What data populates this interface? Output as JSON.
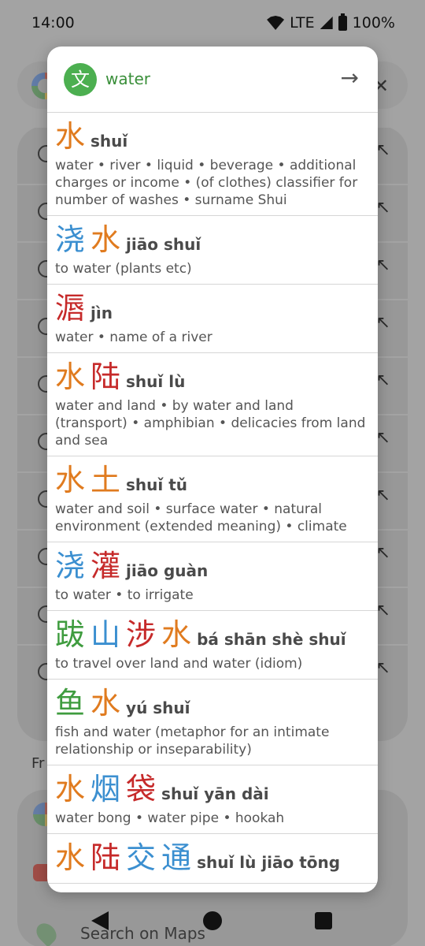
{
  "status_bar": {
    "time": "14:00",
    "network": "LTE",
    "battery": "100%"
  },
  "background": {
    "section_label": "Fr",
    "maps_label": "Search on Maps",
    "row_count": 10
  },
  "popup": {
    "app_icon_glyph": "文",
    "query": "water",
    "go_icon": "arrow-right",
    "entries": [
      {
        "chars": [
          {
            "c": "水",
            "tone": 1
          }
        ],
        "pinyin": "shuǐ",
        "definition": "water • river • liquid • beverage • additional charges or income • (of clothes) classifier for number of washes • surname Shui"
      },
      {
        "chars": [
          {
            "c": "浇",
            "tone": 2
          },
          {
            "c": "水",
            "tone": 1
          }
        ],
        "pinyin": "jiāo shuǐ",
        "definition": "to water (plants etc)"
      },
      {
        "chars": [
          {
            "c": "滣",
            "tone": 3
          }
        ],
        "pinyin": "jìn",
        "definition": "water • name of a river"
      },
      {
        "chars": [
          {
            "c": "水",
            "tone": 1
          },
          {
            "c": "陆",
            "tone": 3
          }
        ],
        "pinyin": "shuǐ lù",
        "definition": "water and land • by water and land (transport) • amphibian • delicacies from land and sea"
      },
      {
        "chars": [
          {
            "c": "水",
            "tone": 1
          },
          {
            "c": "土",
            "tone": 1
          }
        ],
        "pinyin": "shuǐ tǔ",
        "definition": "water and soil • surface water • natural environment (extended meaning) • climate"
      },
      {
        "chars": [
          {
            "c": "浇",
            "tone": 2
          },
          {
            "c": "灌",
            "tone": 3
          }
        ],
        "pinyin": "jiāo guàn",
        "definition": "to water • to irrigate"
      },
      {
        "chars": [
          {
            "c": "跋",
            "tone": 4
          },
          {
            "c": "山",
            "tone": 2
          },
          {
            "c": "涉",
            "tone": 3
          },
          {
            "c": "水",
            "tone": 1
          }
        ],
        "pinyin": "bá shān shè shuǐ",
        "definition": "to travel over land and water (idiom)"
      },
      {
        "chars": [
          {
            "c": "鱼",
            "tone": 4
          },
          {
            "c": "水",
            "tone": 1
          }
        ],
        "pinyin": "yú shuǐ",
        "definition": "fish and water (metaphor for an intimate relationship or inseparability)"
      },
      {
        "chars": [
          {
            "c": "水",
            "tone": 1
          },
          {
            "c": "烟",
            "tone": 2
          },
          {
            "c": "袋",
            "tone": 3
          }
        ],
        "pinyin": "shuǐ yān dài",
        "definition": "water bong • water pipe • hookah"
      },
      {
        "chars": [
          {
            "c": "水",
            "tone": 1
          },
          {
            "c": "陆",
            "tone": 3
          },
          {
            "c": "交",
            "tone": 2
          },
          {
            "c": "通",
            "tone": 2
          }
        ],
        "pinyin": "shuǐ lù jiāo tōng",
        "definition": ""
      }
    ]
  },
  "tone_colors": {
    "tone1": "#e07b1f",
    "tone2": "#3b8fd0",
    "tone3": "#c62a2a",
    "tone4": "#3f9c3f",
    "query_color": "#3a8f3a"
  }
}
